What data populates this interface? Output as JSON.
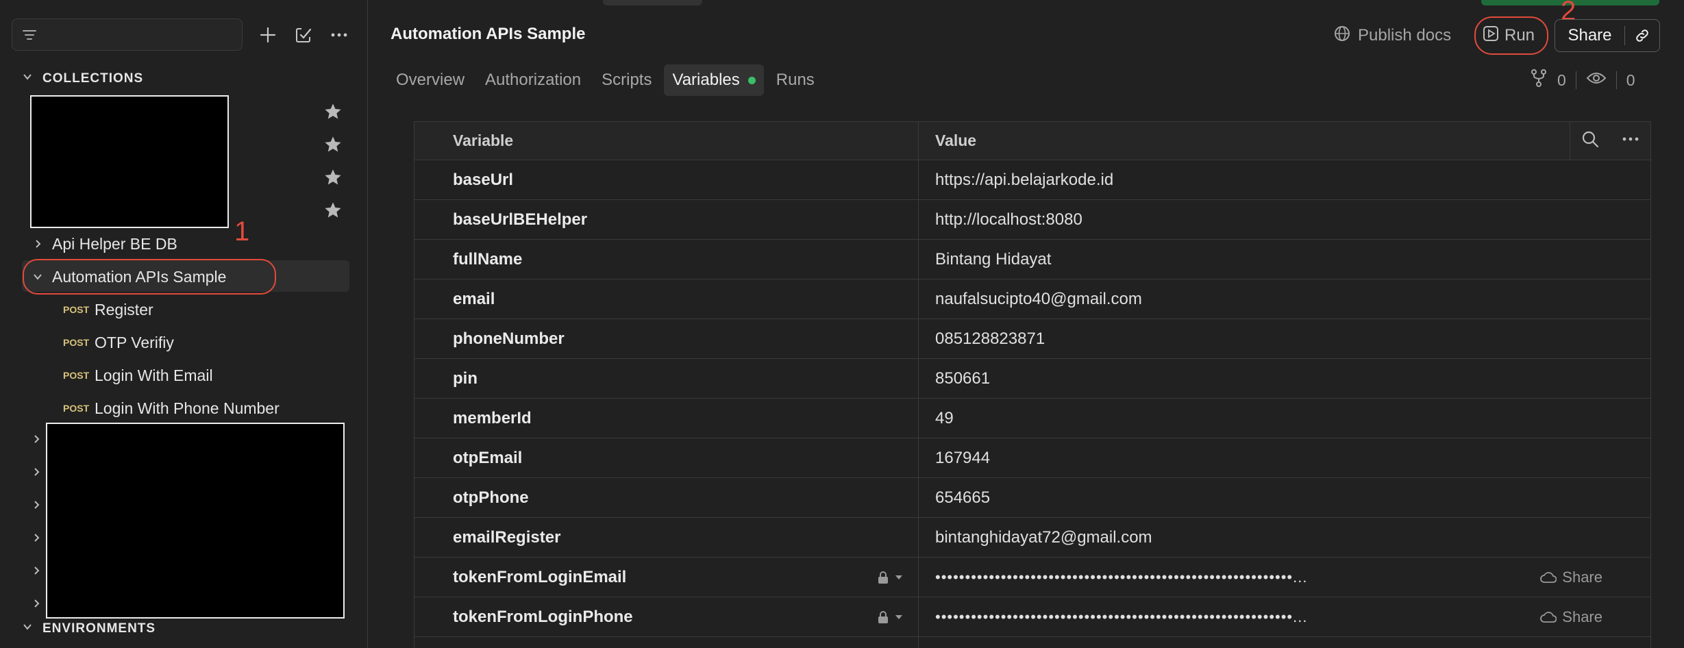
{
  "sidebar": {
    "collections_label": "COLLECTIONS",
    "environments_label": "ENVIRONMENTS",
    "items": [
      {
        "name": "Api Helper BE DB"
      },
      {
        "name": "Automation APIs Sample"
      }
    ],
    "requests": [
      {
        "method": "POST",
        "name": "Register"
      },
      {
        "method": "POST",
        "name": "OTP Verifiy"
      },
      {
        "method": "POST",
        "name": "Login With Email"
      },
      {
        "method": "POST",
        "name": "Login With Phone Number"
      }
    ]
  },
  "annotations": {
    "one": "1",
    "two": "2"
  },
  "header": {
    "title": "Automation APIs Sample",
    "publish_label": "Publish docs",
    "run_label": "Run",
    "share_label": "Share"
  },
  "tabs": [
    {
      "label": "Overview"
    },
    {
      "label": "Authorization"
    },
    {
      "label": "Scripts"
    },
    {
      "label": "Variables"
    },
    {
      "label": "Runs"
    }
  ],
  "counters": {
    "forks": "0",
    "watchers": "0"
  },
  "table": {
    "headers": {
      "variable": "Variable",
      "value": "Value"
    },
    "rows": [
      {
        "variable": "baseUrl",
        "value": "https://api.belajarkode.id"
      },
      {
        "variable": "baseUrlBEHelper",
        "value": "http://localhost:8080"
      },
      {
        "variable": "fullName",
        "value": "Bintang Hidayat"
      },
      {
        "variable": "email",
        "value": "naufalsucipto40@gmail.com"
      },
      {
        "variable": "phoneNumber",
        "value": "085128823871"
      },
      {
        "variable": "pin",
        "value": "850661"
      },
      {
        "variable": "memberId",
        "value": "49"
      },
      {
        "variable": "otpEmail",
        "value": "167944"
      },
      {
        "variable": "otpPhone",
        "value": "654665"
      },
      {
        "variable": "emailRegister",
        "value": "bintanghidayat72@gmail.com"
      }
    ],
    "secret_rows": [
      {
        "variable": "tokenFromLoginEmail",
        "value": "••••••••••••••••••••••••••••••••••••••••••••••••••••••••••••...",
        "share": "Share"
      },
      {
        "variable": "tokenFromLoginPhone",
        "value": "••••••••••••••••••••••••••••••••••••••••••••••••••••••••••••...",
        "share": "Share"
      }
    ]
  },
  "colors": {
    "accent_red": "#e14a3c",
    "active_dot": "#3bbf6a"
  }
}
